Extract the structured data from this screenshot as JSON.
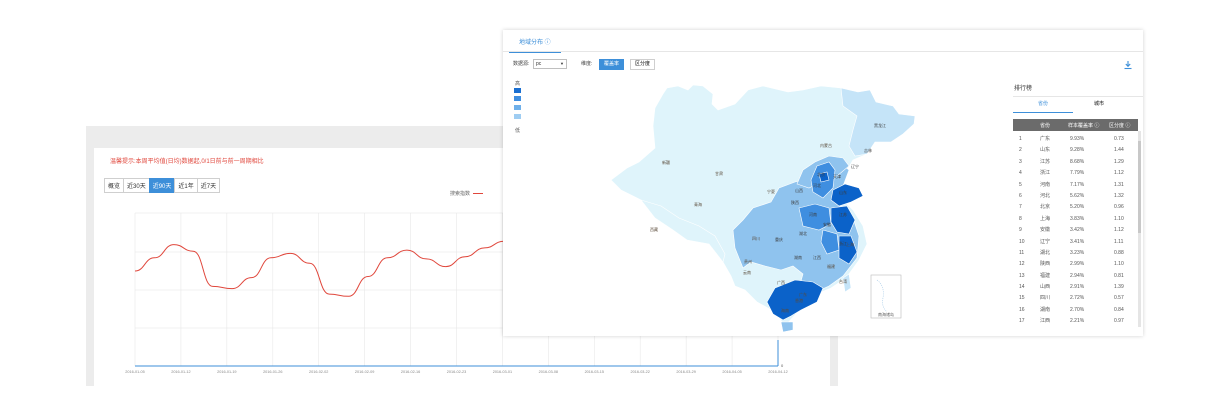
{
  "back": {
    "note_red": "温馨提示:本周平均值(日均)数据起,0/1日前与前一周期相比",
    "note_rest": "",
    "tabs": [
      {
        "label": "概览",
        "active": false
      },
      {
        "label": "近30天",
        "active": false
      },
      {
        "label": "近90天",
        "active": true
      },
      {
        "label": "近1年",
        "active": false
      },
      {
        "label": "近7天",
        "active": false
      }
    ],
    "legend_label": "搜索指数",
    "line_color": "#e0473c",
    "axis_zero": "0",
    "series_y": [
      250,
      262,
      274,
      268,
      236,
      234,
      244,
      262,
      266,
      257,
      229,
      227,
      245,
      262,
      269,
      261,
      254,
      263,
      271,
      277
    ],
    "x_ticks": [
      "2016-01-05",
      "2016-01-12",
      "2016-01-19",
      "2016-01-26",
      "2016-02-02",
      "2016-02-09",
      "2016-02-16",
      "2016-02-23",
      "2016-03-01",
      "2016-03-08",
      "2016-03-15",
      "2016-03-22",
      "2016-03-29",
      "2016-04-05",
      "2016-04-12"
    ]
  },
  "map_panel": {
    "tab_label": "地域分布 ⓘ",
    "data_source_label": "数据源:",
    "data_source_value": "pc",
    "dimension_label": "维度:",
    "dimensions": [
      {
        "label": "覆盖率",
        "active": true
      },
      {
        "label": "区分度",
        "active": false
      }
    ],
    "scale_high": "高",
    "scale_low": "低",
    "scale_colors": [
      "#1a6fd1",
      "#3f8ee0",
      "#6fb0ea",
      "#9fcdf2"
    ],
    "colors": {
      "level1": "#0b62c9",
      "level2": "#3f8ee0",
      "level3": "#8fc3ee",
      "level4": "#c5e4f8",
      "level5": "#dff4fb"
    },
    "map_labels": [
      "黑龙江",
      "吉林",
      "辽宁",
      "内蒙古",
      "北京",
      "天津",
      "河北",
      "山西",
      "山东",
      "新疆",
      "甘肃",
      "宁夏",
      "陕西",
      "河南",
      "江苏",
      "安徽",
      "青海",
      "西藏",
      "四川",
      "重庆",
      "湖北",
      "浙江",
      "上海",
      "贵州",
      "湖南",
      "江西",
      "福建",
      "云南",
      "广西",
      "广东",
      "海南",
      "台湾",
      "香港"
    ],
    "inset_label": "南海诸岛",
    "ranking": {
      "title": "排行榜",
      "tabs": [
        {
          "label": "省份",
          "active": true
        },
        {
          "label": "城市",
          "active": false
        }
      ],
      "headers": [
        "省份",
        "样本覆盖率 ⓘ",
        "区分度 ⓘ"
      ],
      "rows": [
        [
          "1",
          "广东",
          "9.93%",
          "0.73"
        ],
        [
          "2",
          "山东",
          "9.28%",
          "1.44"
        ],
        [
          "3",
          "江苏",
          "8.68%",
          "1.29"
        ],
        [
          "4",
          "浙江",
          "7.79%",
          "1.12"
        ],
        [
          "5",
          "河南",
          "7.17%",
          "1.31"
        ],
        [
          "6",
          "河北",
          "5.62%",
          "1.32"
        ],
        [
          "7",
          "北京",
          "5.20%",
          "0.96"
        ],
        [
          "8",
          "上海",
          "3.83%",
          "1.10"
        ],
        [
          "9",
          "安徽",
          "3.42%",
          "1.12"
        ],
        [
          "10",
          "辽宁",
          "3.41%",
          "1.11"
        ],
        [
          "11",
          "湖北",
          "3.23%",
          "0.88"
        ],
        [
          "12",
          "陕西",
          "2.99%",
          "1.10"
        ],
        [
          "13",
          "福建",
          "2.94%",
          "0.81"
        ],
        [
          "14",
          "山西",
          "2.91%",
          "1.39"
        ],
        [
          "15",
          "四川",
          "2.72%",
          "0.57"
        ],
        [
          "16",
          "湖南",
          "2.70%",
          "0.84"
        ],
        [
          "17",
          "江西",
          "2.21%",
          "0.97"
        ]
      ]
    }
  }
}
